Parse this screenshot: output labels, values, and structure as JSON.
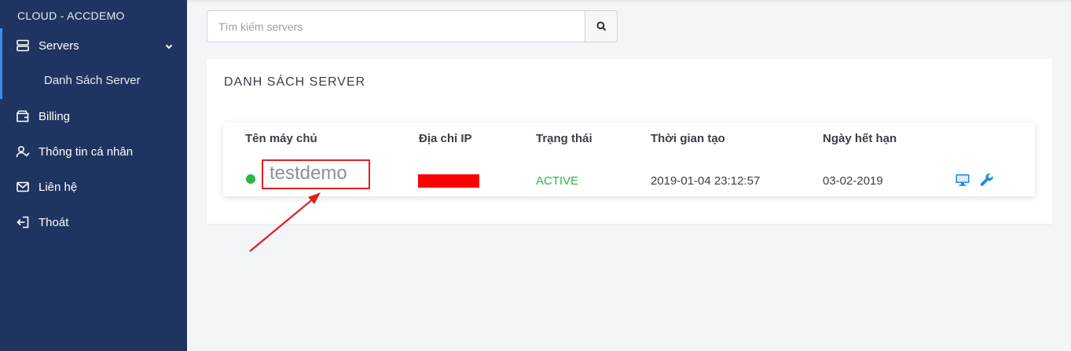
{
  "sidebar": {
    "brand": "CLOUD - ACCDEMO",
    "items": [
      {
        "label": "Servers",
        "icon": "server-icon"
      },
      {
        "label": "Billing",
        "icon": "wallet-icon"
      },
      {
        "label": "Thông tin cá nhân",
        "icon": "user-check-icon"
      },
      {
        "label": "Liên hệ",
        "icon": "mail-icon"
      },
      {
        "label": "Thoát",
        "icon": "logout-icon"
      }
    ],
    "subitem": "Danh Sách Server"
  },
  "search": {
    "placeholder": "Tìm kiếm servers",
    "button_icon": "search-icon"
  },
  "card": {
    "title": "DANH SÁCH SERVER",
    "columns": [
      "Tên máy chủ",
      "Địa chỉ IP",
      "Trạng thái",
      "Thời gian tạo",
      "Ngày hết hạn"
    ],
    "rows": [
      {
        "name": "testdemo",
        "ip": "",
        "status": "ACTIVE",
        "created": "2019-01-04 23:12:57",
        "expires": "03-02-2019",
        "actions": [
          "monitor-icon",
          "wrench-icon"
        ]
      }
    ]
  },
  "colors": {
    "sidebar_bg": "#1f3460",
    "accent": "#3a8ee6",
    "status_active": "#2fb344",
    "annotation": "#e02020",
    "action_icon": "#1e88e5"
  }
}
